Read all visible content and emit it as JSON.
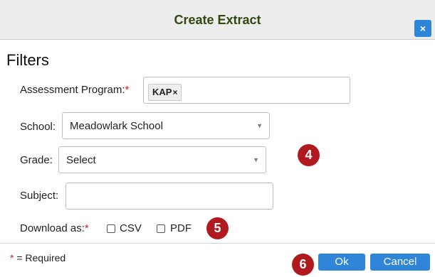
{
  "dialog": {
    "title": "Create Extract",
    "close_label": "×"
  },
  "filters": {
    "heading": "Filters",
    "assessment_program": {
      "label": "Assessment Program:",
      "required_mark": "*",
      "tag": "KAP",
      "tag_remove": "×"
    },
    "school": {
      "label": "School:",
      "value": "Meadowlark School"
    },
    "grade": {
      "label": "Grade:",
      "value": "Select"
    },
    "subject": {
      "label": "Subject:",
      "value": ""
    },
    "download": {
      "label": "Download as:",
      "required_mark": "*",
      "options": [
        "CSV",
        "PDF"
      ]
    }
  },
  "footer": {
    "required_mark": "*",
    "required_note": " = Required",
    "ok_label": "Ok",
    "cancel_label": "Cancel"
  },
  "callouts": [
    "4",
    "5",
    "6"
  ],
  "colors": {
    "title_text": "#2f4a10",
    "accent_button": "#2f86d8",
    "callout": "#b01a1e",
    "required": "#cc2222"
  }
}
